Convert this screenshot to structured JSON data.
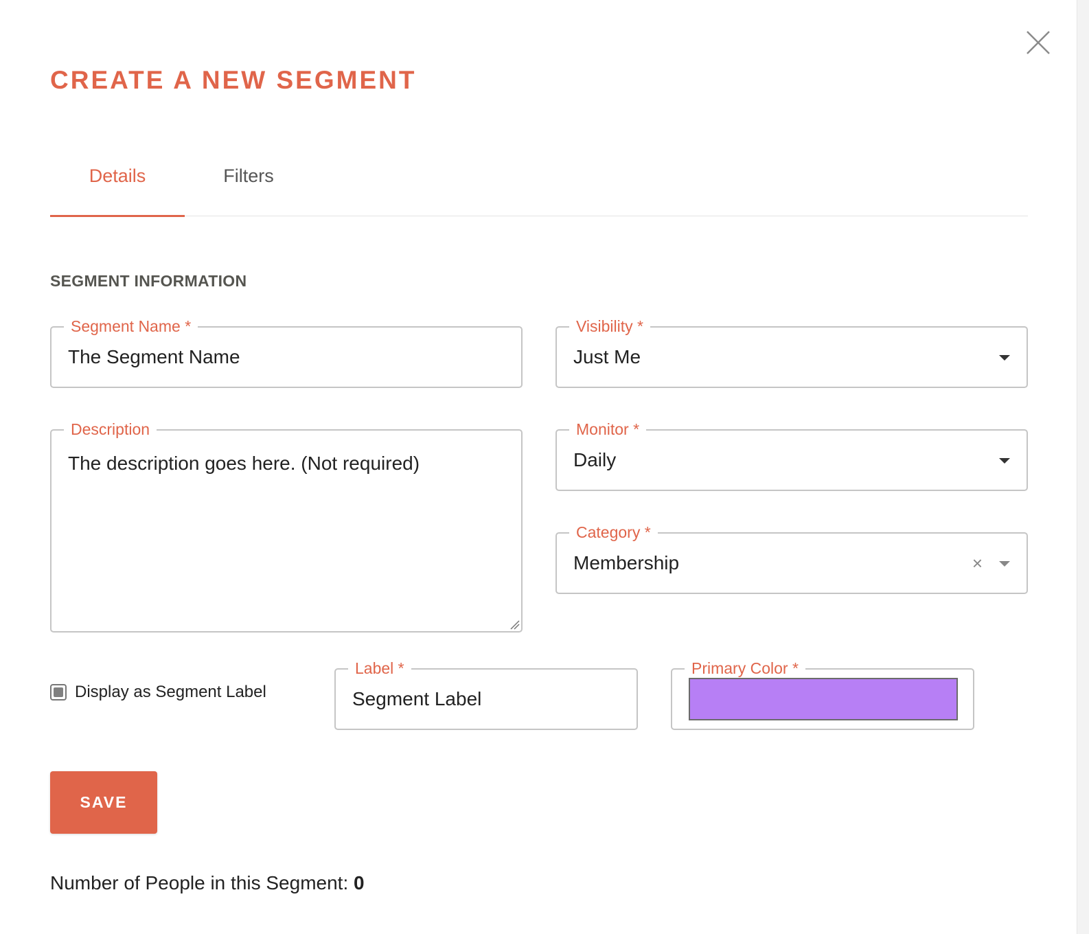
{
  "modal": {
    "title": "CREATE A NEW SEGMENT",
    "tabs": [
      {
        "label": "Details",
        "active": true
      },
      {
        "label": "Filters",
        "active": false
      }
    ]
  },
  "section": {
    "heading": "SEGMENT INFORMATION"
  },
  "fields": {
    "segment_name": {
      "label": "Segment Name *",
      "value": "The Segment Name"
    },
    "visibility": {
      "label": "Visibility *",
      "value": "Just Me"
    },
    "description": {
      "label": "Description",
      "value": "The description goes here. (Not required)"
    },
    "monitor": {
      "label": "Monitor *",
      "value": "Daily"
    },
    "category": {
      "label": "Category *",
      "value": "Membership",
      "clear_symbol": "×"
    },
    "display_as_label": {
      "label": "Display as Segment Label",
      "checked": "indeterminate"
    },
    "label": {
      "label": "Label *",
      "value": "Segment Label"
    },
    "primary_color": {
      "label": "Primary Color *",
      "value": "#b77ff5"
    }
  },
  "save_label": "SAVE",
  "footer": {
    "people_count_label": "Number of People in this Segment:",
    "people_count_value": "0"
  },
  "colors": {
    "accent": "#e0654a",
    "border": "#c5c5c5",
    "swatch": "#b77ff5"
  },
  "icons": {
    "close": "close-icon",
    "dropdown": "caret-down-icon",
    "clear": "clear-icon",
    "resize": "resize-grip-icon"
  }
}
